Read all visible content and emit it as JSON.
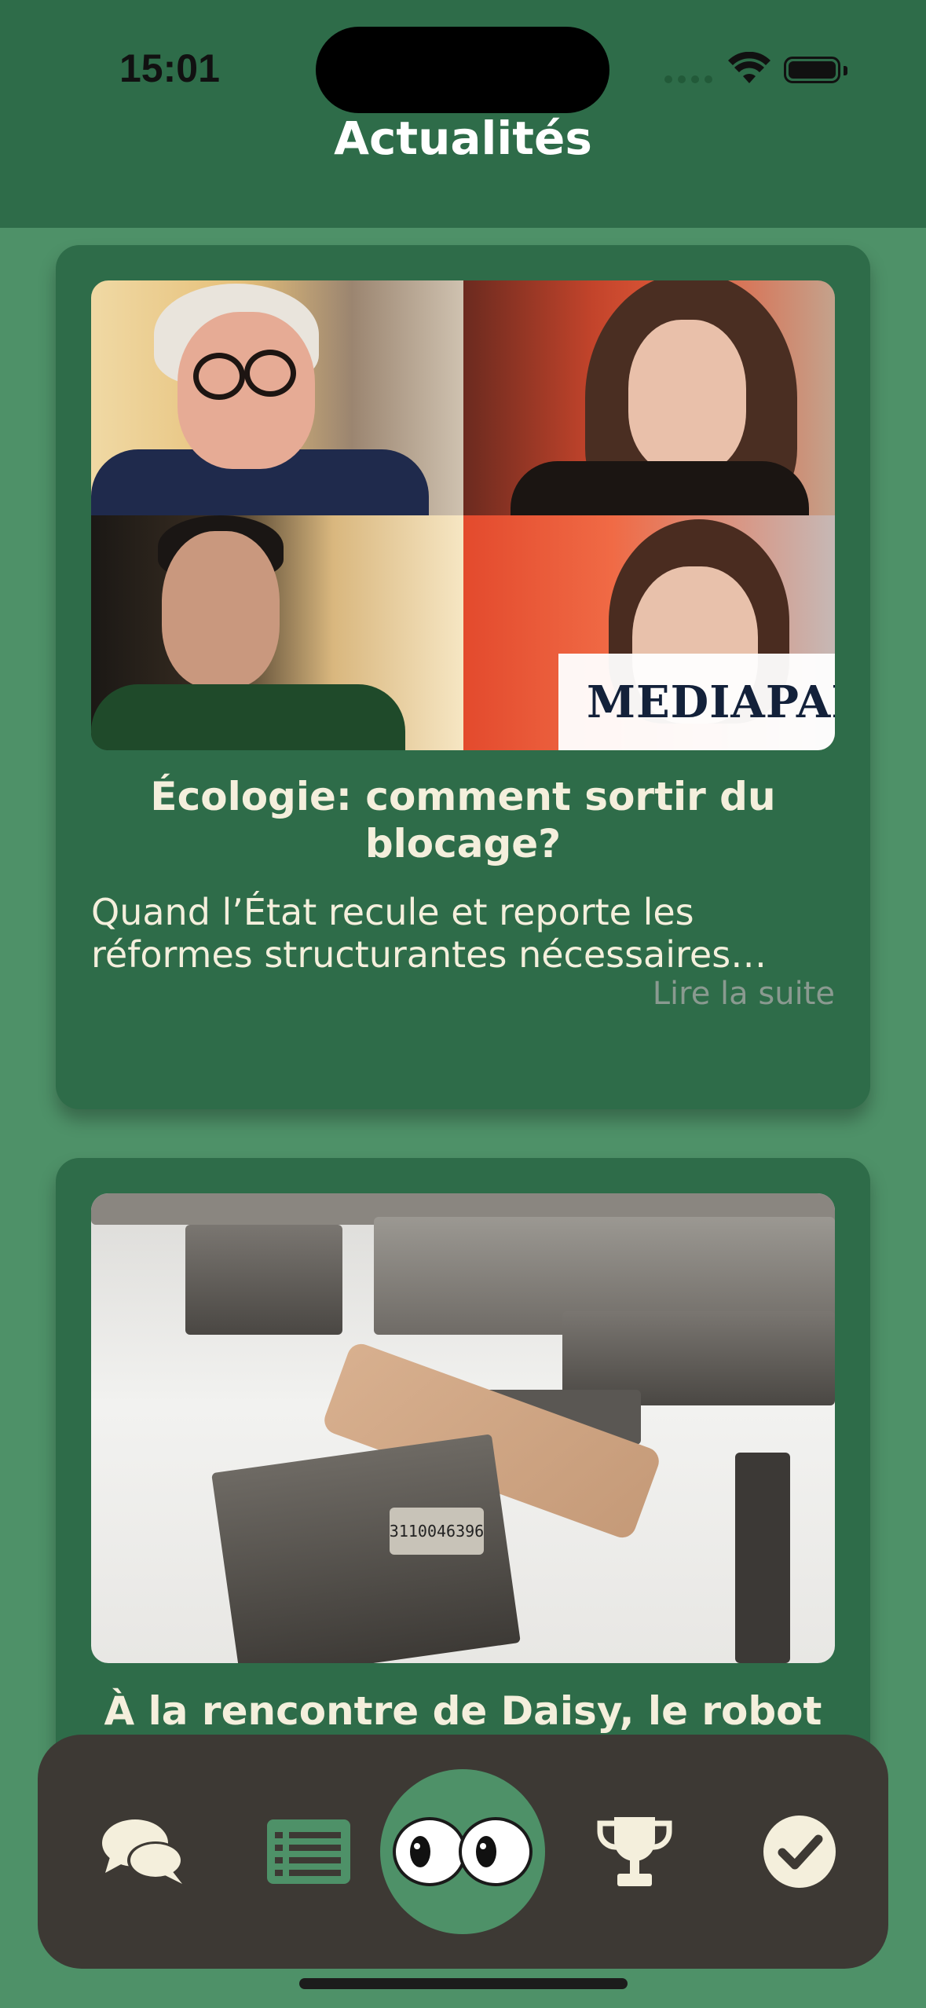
{
  "status_bar": {
    "time": "15:01"
  },
  "header": {
    "title": "Actualités"
  },
  "articles": [
    {
      "title": "Écologie: comment sortir du blocage?",
      "excerpt": "Quand l’État recule et reporte les réformes structurantes nécessaires…",
      "read_more": "Lire la suite",
      "image_brand": "MEDIAPART"
    },
    {
      "title": "À la rencontre de Daisy, le robot",
      "image_label": "3110046396"
    }
  ],
  "tab_bar": {
    "items": [
      {
        "icon": "chat-bubbles-icon"
      },
      {
        "icon": "list-icon"
      },
      {
        "icon": "eyes-icon",
        "selected": true
      },
      {
        "icon": "trophy-icon"
      },
      {
        "icon": "checkmark-circle-icon"
      }
    ]
  },
  "colors": {
    "page_background": "#4e9168",
    "header_background": "#2e6c49",
    "card_background": "#2e6c49",
    "tab_bar_background": "#3d3934",
    "text_cream": "#f4efdc",
    "read_more": "#8a9a90"
  }
}
